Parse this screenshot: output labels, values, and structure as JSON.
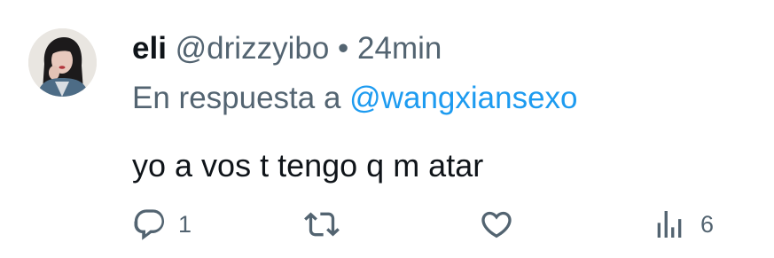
{
  "tweet": {
    "author_name": "eli",
    "handle": "@drizzyibo",
    "separator": "•",
    "time": "24min",
    "reply_prefix": "En respuesta a",
    "reply_to": "@wangxiansexo",
    "text": "yo a vos t tengo q m atar"
  },
  "actions": {
    "reply": {
      "icon": "reply-icon",
      "count": "1"
    },
    "retweet": {
      "icon": "retweet-icon",
      "count": ""
    },
    "like": {
      "icon": "heart-icon",
      "count": ""
    },
    "views": {
      "icon": "views-icon",
      "count": "6"
    }
  },
  "colors": {
    "text": "#0f1419",
    "secondary": "#536471",
    "link": "#1d9bf0"
  }
}
